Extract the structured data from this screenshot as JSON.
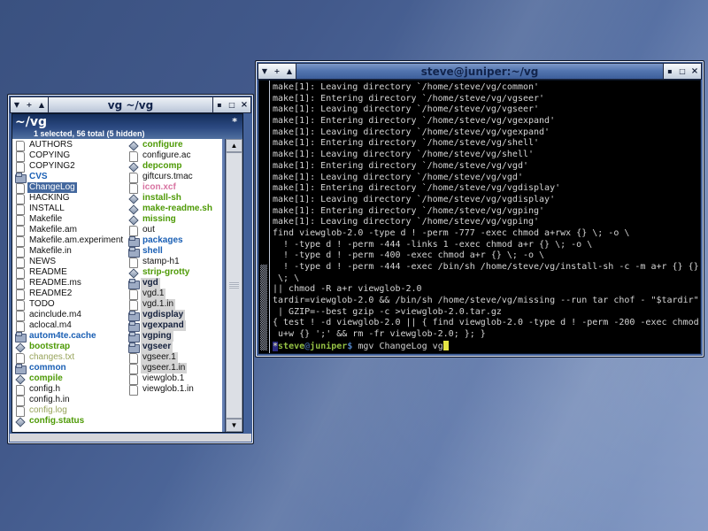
{
  "file_window": {
    "title": "vg ~/vg",
    "titlebar_buttons_left": [
      {
        "name": "shade",
        "glyph": "▼"
      },
      {
        "name": "stick",
        "glyph": "+"
      },
      {
        "name": "unshade",
        "glyph": "▲"
      }
    ],
    "titlebar_buttons_right": [
      {
        "name": "iconify",
        "glyph": "▪"
      },
      {
        "name": "maximize",
        "glyph": "□"
      },
      {
        "name": "close",
        "glyph": "×"
      }
    ],
    "header": {
      "path": "~/vg",
      "indicator": "*",
      "status": "1 selected, 56 total (5 hidden)"
    },
    "scrollbar": {
      "up_glyph": "▲",
      "down_glyph": "▼"
    },
    "columns": [
      [
        {
          "name": "AUTHORS",
          "icon": "file",
          "style": "reg"
        },
        {
          "name": "COPYING",
          "icon": "file",
          "style": "reg"
        },
        {
          "name": "COPYING2",
          "icon": "file",
          "style": "reg"
        },
        {
          "name": "CVS",
          "icon": "folder",
          "style": "dir"
        },
        {
          "name": "ChangeLog",
          "icon": "file",
          "style": "sel"
        },
        {
          "name": "HACKING",
          "icon": "file",
          "style": "reg"
        },
        {
          "name": "INSTALL",
          "icon": "file",
          "style": "reg"
        },
        {
          "name": "Makefile",
          "icon": "file",
          "style": "reg"
        },
        {
          "name": "Makefile.am",
          "icon": "file",
          "style": "reg"
        },
        {
          "name": "Makefile.am.experiment",
          "icon": "file",
          "style": "reg"
        },
        {
          "name": "Makefile.in",
          "icon": "file",
          "style": "reg"
        },
        {
          "name": "NEWS",
          "icon": "file",
          "style": "reg"
        },
        {
          "name": "README",
          "icon": "file",
          "style": "reg"
        },
        {
          "name": "README.ms",
          "icon": "file",
          "style": "reg"
        },
        {
          "name": "README2",
          "icon": "file",
          "style": "reg"
        },
        {
          "name": "TODO",
          "icon": "file",
          "style": "reg"
        },
        {
          "name": "acinclude.m4",
          "icon": "file",
          "style": "reg"
        },
        {
          "name": "aclocal.m4",
          "icon": "file",
          "style": "reg"
        },
        {
          "name": "autom4te.cache",
          "icon": "folder",
          "style": "dir"
        },
        {
          "name": "bootstrap",
          "icon": "exec",
          "style": "exec"
        },
        {
          "name": "changes.txt",
          "icon": "file",
          "style": "dim"
        },
        {
          "name": "common",
          "icon": "folder",
          "style": "dir"
        },
        {
          "name": "compile",
          "icon": "exec",
          "style": "exec"
        },
        {
          "name": "config.h",
          "icon": "file",
          "style": "reg"
        },
        {
          "name": "config.h.in",
          "icon": "file",
          "style": "reg"
        },
        {
          "name": "config.log",
          "icon": "file",
          "style": "dim"
        },
        {
          "name": "config.status",
          "icon": "exec",
          "style": "exec"
        }
      ],
      [
        {
          "name": "configure",
          "icon": "exec",
          "style": "exec"
        },
        {
          "name": "configure.ac",
          "icon": "file",
          "style": "reg"
        },
        {
          "name": "depcomp",
          "icon": "exec",
          "style": "exec"
        },
        {
          "name": "giftcurs.tmac",
          "icon": "file",
          "style": "reg"
        },
        {
          "name": "icon.xcf",
          "icon": "file",
          "style": "img"
        },
        {
          "name": "install-sh",
          "icon": "exec",
          "style": "exec"
        },
        {
          "name": "make-readme.sh",
          "icon": "exec",
          "style": "exec"
        },
        {
          "name": "missing",
          "icon": "exec",
          "style": "exec"
        },
        {
          "name": "out",
          "icon": "file",
          "style": "reg"
        },
        {
          "name": "packages",
          "icon": "folder",
          "style": "dir"
        },
        {
          "name": "shell",
          "icon": "folder",
          "style": "dir"
        },
        {
          "name": "stamp-h1",
          "icon": "file",
          "style": "reg"
        },
        {
          "name": "strip-grotty",
          "icon": "exec",
          "style": "exec"
        },
        {
          "name": "vgd",
          "icon": "folder",
          "style": "globdir"
        },
        {
          "name": "vgd.1",
          "icon": "file",
          "style": "glob"
        },
        {
          "name": "vgd.1.in",
          "icon": "file",
          "style": "glob"
        },
        {
          "name": "vgdisplay",
          "icon": "folder",
          "style": "globdir"
        },
        {
          "name": "vgexpand",
          "icon": "folder",
          "style": "globdir"
        },
        {
          "name": "vgping",
          "icon": "folder",
          "style": "globdir"
        },
        {
          "name": "vgseer",
          "icon": "folder",
          "style": "globdir"
        },
        {
          "name": "vgseer.1",
          "icon": "file",
          "style": "glob"
        },
        {
          "name": "vgseer.1.in",
          "icon": "file",
          "style": "glob"
        },
        {
          "name": "viewglob.1",
          "icon": "file",
          "style": "reg"
        },
        {
          "name": "viewglob.1.in",
          "icon": "file",
          "style": "reg"
        }
      ]
    ]
  },
  "terminal_window": {
    "title": "steve@juniper:~/vg",
    "titlebar_buttons_left": [
      {
        "name": "shade",
        "glyph": "▼"
      },
      {
        "name": "stick",
        "glyph": "+"
      },
      {
        "name": "unshade",
        "glyph": "▲"
      }
    ],
    "titlebar_buttons_right": [
      {
        "name": "iconify",
        "glyph": "▪"
      },
      {
        "name": "maximize",
        "glyph": "□"
      },
      {
        "name": "close",
        "glyph": "×"
      }
    ],
    "lines": [
      "make[1]: Leaving directory `/home/steve/vg/common'",
      "make[1]: Entering directory `/home/steve/vg/vgseer'",
      "make[1]: Leaving directory `/home/steve/vg/vgseer'",
      "make[1]: Entering directory `/home/steve/vg/vgexpand'",
      "make[1]: Leaving directory `/home/steve/vg/vgexpand'",
      "make[1]: Entering directory `/home/steve/vg/shell'",
      "make[1]: Leaving directory `/home/steve/vg/shell'",
      "make[1]: Entering directory `/home/steve/vg/vgd'",
      "make[1]: Leaving directory `/home/steve/vg/vgd'",
      "make[1]: Entering directory `/home/steve/vg/vgdisplay'",
      "make[1]: Leaving directory `/home/steve/vg/vgdisplay'",
      "make[1]: Entering directory `/home/steve/vg/vgping'",
      "make[1]: Leaving directory `/home/steve/vg/vgping'",
      "find viewglob-2.0 -type d ! -perm -777 -exec chmod a+rwx {} \\; -o \\",
      "  ! -type d ! -perm -444 -links 1 -exec chmod a+r {} \\; -o \\",
      "  ! -type d ! -perm -400 -exec chmod a+r {} \\; -o \\",
      "  ! -type d ! -perm -444 -exec /bin/sh /home/steve/vg/install-sh -c -m a+r {} {}",
      " \\; \\",
      "|| chmod -R a+r viewglob-2.0",
      "tardir=viewglob-2.0 && /bin/sh /home/steve/vg/missing --run tar chof - \"$tardir\"",
      " | GZIP=--best gzip -c >viewglob-2.0.tar.gz",
      "{ test ! -d viewglob-2.0 || { find viewglob-2.0 -type d ! -perm -200 -exec chmod",
      " u+w {} ';' && rm -fr viewglob-2.0; }; }"
    ],
    "prompt": {
      "star": "*",
      "user": "steve",
      "at": "@",
      "host": "juniper",
      "dollar": "$",
      "command": " mgv ChangeLog vg"
    }
  }
}
